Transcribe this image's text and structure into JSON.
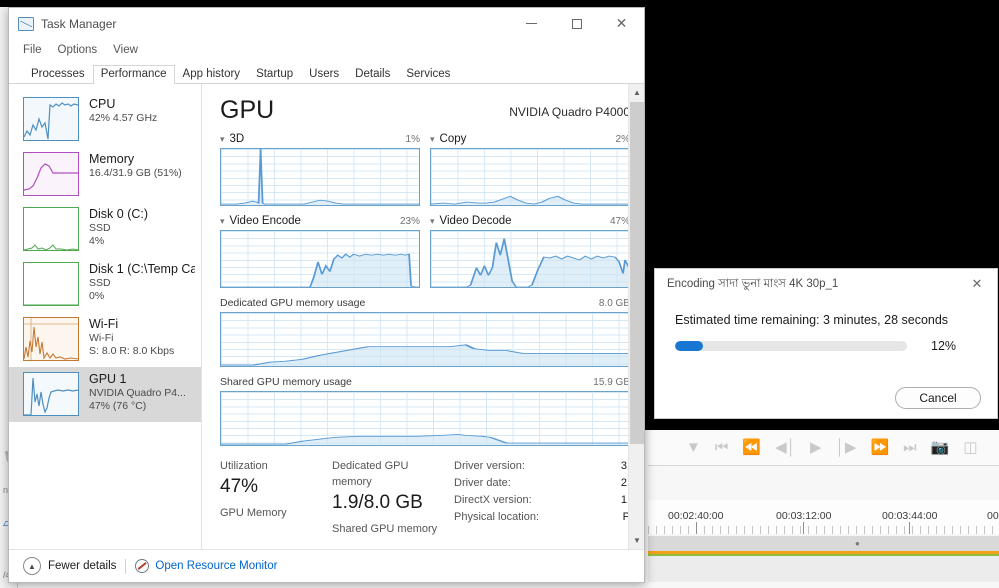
{
  "window": {
    "title": "Task Manager",
    "icon": "task-manager-icon",
    "controls": {
      "minimize": "—",
      "maximize": "□",
      "close": "✕"
    }
  },
  "menu": [
    "File",
    "Options",
    "View"
  ],
  "tabs": [
    {
      "label": "Processes",
      "active": false
    },
    {
      "label": "Performance",
      "active": true
    },
    {
      "label": "App history",
      "active": false
    },
    {
      "label": "Startup",
      "active": false
    },
    {
      "label": "Users",
      "active": false
    },
    {
      "label": "Details",
      "active": false
    },
    {
      "label": "Services",
      "active": false
    }
  ],
  "sidebar": {
    "items": [
      {
        "name": "CPU",
        "sub1": "42%  4.57 GHz",
        "sub2": "",
        "color": "#4f8fc0",
        "selected": false
      },
      {
        "name": "Memory",
        "sub1": "16.4/31.9 GB (51%)",
        "sub2": "",
        "color": "#b04fc0",
        "selected": false
      },
      {
        "name": "Disk 0 (C:)",
        "sub1": "SSD",
        "sub2": "4%",
        "color": "#4fa84f",
        "selected": false
      },
      {
        "name": "Disk 1 (C:\\Temp Ca",
        "sub1": "SSD",
        "sub2": "0%",
        "color": "#4fa84f",
        "selected": false
      },
      {
        "name": "Wi-Fi",
        "sub1": "Wi-Fi",
        "sub2": "S: 8.0 R: 8.0 Kbps",
        "color": "#c57a33",
        "selected": false
      },
      {
        "name": "GPU 1",
        "sub1": "NVIDIA Quadro P4...",
        "sub2": "47%  (76 °C)",
        "color": "#4f8fc0",
        "selected": true
      }
    ]
  },
  "detail": {
    "title": "GPU",
    "device": "NVIDIA Quadro P4000",
    "engines": [
      {
        "label": "3D",
        "value": "1%"
      },
      {
        "label": "Copy",
        "value": "2%"
      },
      {
        "label": "Video Encode",
        "value": "23%"
      },
      {
        "label": "Video Decode",
        "value": "47%"
      }
    ],
    "memory_graphs": [
      {
        "label": "Dedicated GPU memory usage",
        "value": "8.0 GB"
      },
      {
        "label": "Shared GPU memory usage",
        "value": "15.9 GB"
      }
    ],
    "stats": [
      {
        "caption": "Utilization",
        "value": "47%",
        "caption2": "GPU Memory"
      },
      {
        "caption": "Dedicated GPU memory",
        "value": "1.9/8.0 GB",
        "caption2": "Shared GPU memory"
      }
    ],
    "info": [
      {
        "label": "Driver version:",
        "value": "3."
      },
      {
        "label": "Driver date:",
        "value": "2."
      },
      {
        "label": "DirectX version:",
        "value": "1."
      },
      {
        "label": "Physical location:",
        "value": "P"
      }
    ]
  },
  "statusbar": {
    "fewer_details": "Fewer details",
    "resource_monitor": "Open Resource Monitor"
  },
  "encoding_dialog": {
    "title": "Encoding সাদা ভুনা মাংস 4K 30p_1",
    "close": "✕",
    "eta": "Estimated time remaining: 3 minutes, 28 seconds",
    "percent_label": "12%",
    "percent_value": 12,
    "accent": "#1976d2",
    "cancel": "Cancel"
  },
  "video_editor": {
    "transport_icons": [
      "marker-icon",
      "go-to-start-icon",
      "step-back-fast-icon",
      "step-back-icon",
      "play-icon",
      "step-forward-icon",
      "fast-forward-icon",
      "go-to-end-icon",
      "snapshot-icon",
      "overlay-icon"
    ],
    "timecodes": [
      "00:02:40:00",
      "00:03:12:00",
      "00:03:44:00",
      "00:"
    ],
    "track_colors": {
      "orange": "#f0a019",
      "green": "#8dbf3f"
    }
  },
  "chart_data": [
    {
      "type": "area",
      "title": "3D",
      "ylabel": "%",
      "ylim": [
        0,
        100
      ],
      "grid": true,
      "x": [
        0,
        4,
        8,
        12,
        16,
        18,
        19,
        20,
        21,
        22,
        26,
        30,
        34,
        38,
        42,
        46,
        50,
        54,
        58,
        62,
        66,
        70,
        74,
        78,
        82,
        86,
        90,
        94,
        100
      ],
      "values": [
        2,
        2,
        2,
        3,
        6,
        4,
        3,
        100,
        3,
        2,
        2,
        2,
        2,
        2,
        2,
        5,
        8,
        6,
        3,
        2,
        2,
        2,
        2,
        2,
        2,
        2,
        2,
        2,
        2
      ]
    },
    {
      "type": "area",
      "title": "Copy",
      "ylabel": "%",
      "ylim": [
        0,
        100
      ],
      "grid": true,
      "x": [
        0,
        6,
        12,
        18,
        24,
        28,
        32,
        36,
        40,
        44,
        48,
        52,
        56,
        60,
        64,
        68,
        72,
        76,
        80,
        86,
        92,
        100
      ],
      "values": [
        2,
        3,
        2,
        4,
        3,
        3,
        4,
        9,
        14,
        8,
        4,
        3,
        3,
        6,
        13,
        8,
        4,
        3,
        3,
        3,
        2,
        2
      ]
    },
    {
      "type": "area",
      "title": "Video Encode",
      "ylabel": "%",
      "ylim": [
        0,
        100
      ],
      "grid": true,
      "x": [
        0,
        10,
        20,
        30,
        40,
        45,
        48,
        50,
        53,
        56,
        58,
        60,
        63,
        66,
        70,
        74,
        78,
        82,
        86,
        90,
        94,
        96,
        98,
        100
      ],
      "values": [
        0,
        0,
        0,
        0,
        0,
        0,
        18,
        44,
        22,
        40,
        30,
        58,
        52,
        58,
        52,
        58,
        55,
        57,
        56,
        58,
        57,
        58,
        2,
        0
      ]
    },
    {
      "type": "area",
      "title": "Video Decode",
      "ylabel": "%",
      "ylim": [
        0,
        100
      ],
      "grid": true,
      "x": [
        0,
        12,
        20,
        24,
        27,
        30,
        33,
        36,
        39,
        42,
        45,
        48,
        51,
        54,
        58,
        62,
        66,
        70,
        74,
        78,
        82,
        86,
        90,
        94,
        97,
        99,
        100
      ],
      "values": [
        0,
        0,
        2,
        30,
        18,
        34,
        18,
        78,
        54,
        82,
        30,
        2,
        0,
        4,
        34,
        58,
        54,
        58,
        50,
        58,
        52,
        58,
        54,
        58,
        48,
        24,
        44
      ]
    },
    {
      "type": "area",
      "title": "Dedicated GPU memory usage",
      "ylabel": "GB",
      "ylim": [
        0,
        8.0
      ],
      "grid": true,
      "x": [
        0,
        8,
        12,
        16,
        20,
        24,
        28,
        32,
        36,
        40,
        48,
        56,
        60,
        62,
        64,
        66,
        70,
        74,
        78,
        84,
        92,
        100
      ],
      "values": [
        0.15,
        0.15,
        0.45,
        0.5,
        0.9,
        1.4,
        1.9,
        2.4,
        2.85,
        2.85,
        2.85,
        2.9,
        3.3,
        2.7,
        2.6,
        2.55,
        2.5,
        1.9,
        1.9,
        1.9,
        1.9,
        1.9
      ]
    },
    {
      "type": "area",
      "title": "Shared GPU memory usage",
      "ylabel": "GB",
      "ylim": [
        0,
        15.9
      ],
      "grid": true,
      "x": [
        0,
        16,
        20,
        24,
        28,
        34,
        40,
        48,
        54,
        58,
        60,
        64,
        66,
        70,
        76,
        84,
        92,
        100
      ],
      "values": [
        0.05,
        0.05,
        0.35,
        0.6,
        0.85,
        1.0,
        1.05,
        1.05,
        1.1,
        1.35,
        1.1,
        1.05,
        1.0,
        0.25,
        0.2,
        0.2,
        0.2,
        0.2
      ]
    }
  ]
}
